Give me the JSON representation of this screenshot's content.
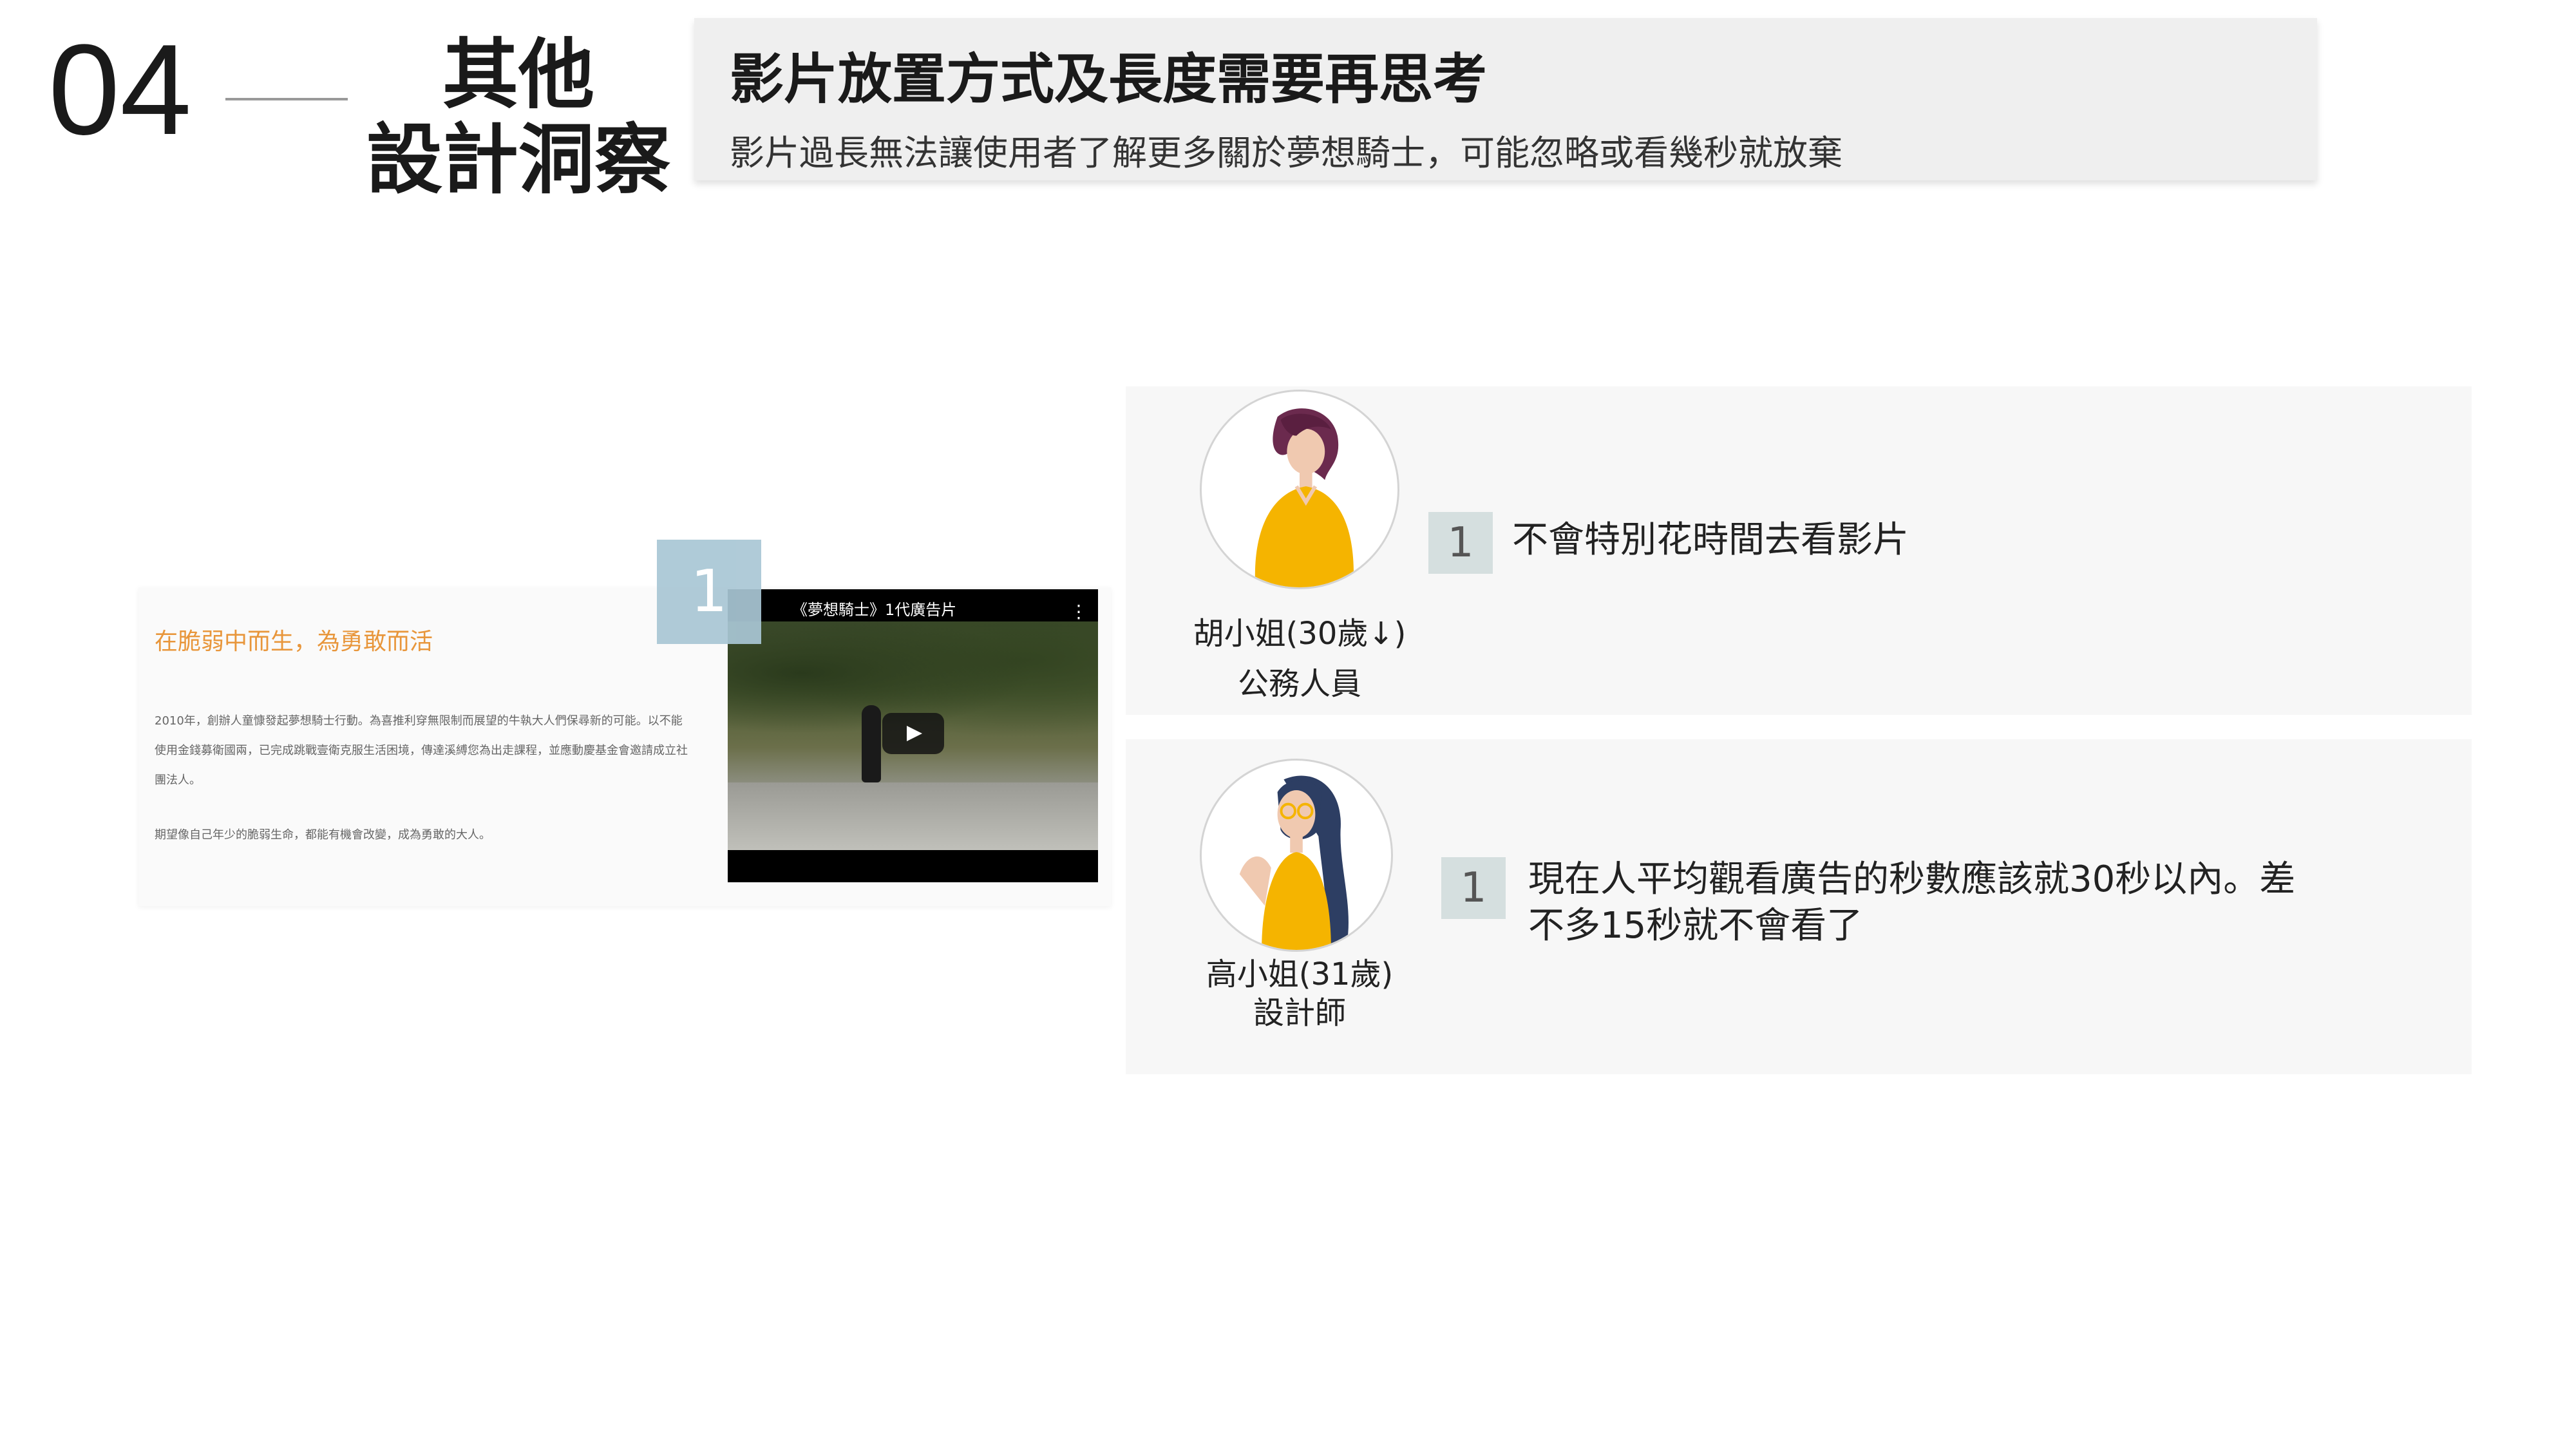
{
  "header": {
    "section_number": "04",
    "title_line1": "其他",
    "title_line2": "設計洞察"
  },
  "insight": {
    "title": "影片放置方式及長度需要再思考",
    "subtitle": "影片過長無法讓使用者了解更多關於夢想騎士，可能忽略或看幾秒就放棄"
  },
  "screenshot": {
    "badge": "1",
    "heading": "在脆弱中而生，為勇敢而活",
    "paragraph1": "2010年，創辦人童慷發起夢想騎士行動。為喜推利穿無限制而展望的牛執大人們保尋新的可能。以不能使用金錢募衛國兩，已完成跳戰壹衛克服生活困境，傳達溪縛您為出走課程，並應動慶基金會邀請成立社團法人。",
    "paragraph2": "期望像自己年少的脆弱生命，都能有機會改變，成為勇敢的大人。",
    "video_title": "《夢想騎士》1代廣告片"
  },
  "interviews": [
    {
      "avatar_icon": "woman-avatar-icon",
      "name": "胡小姐(30歲↓)",
      "role": "公務人員",
      "badge": "1",
      "quote": "不會特別花時間去看影片"
    },
    {
      "avatar_icon": "woman-glasses-avatar-icon",
      "name": "高小姐(31歲)",
      "role": "設計師",
      "badge": "1",
      "quote_line1": "現在人平均觀看廣告的秒數應該就30秒以內。差",
      "quote_line2": "不多15秒就不會看了"
    }
  ],
  "colors": {
    "accent_orange": "#e8963b",
    "badge_blue": "#a9c7d5",
    "badge_grey": "#d5dfdf",
    "avatar_yellow": "#f5b400",
    "hair_purple": "#6b2a4e",
    "hair_navy": "#2d3e63"
  }
}
